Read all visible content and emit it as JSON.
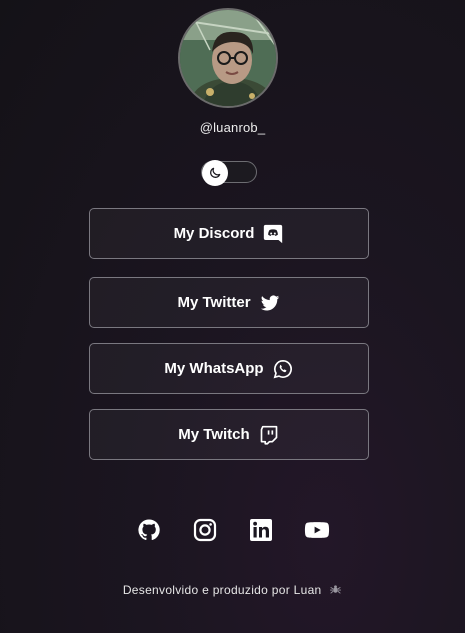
{
  "profile": {
    "username": "@luanrob_",
    "avatar_icon": "profile-photo"
  },
  "theme_toggle": {
    "icon": "moon-icon",
    "state": "dark"
  },
  "links": [
    {
      "label": "My Discord",
      "icon": "discord-icon"
    },
    {
      "label": "My Twitter",
      "icon": "twitter-icon"
    },
    {
      "label": "My WhatsApp",
      "icon": "whatsapp-icon"
    },
    {
      "label": "My Twitch",
      "icon": "twitch-icon"
    }
  ],
  "socials": [
    {
      "icon": "github-icon"
    },
    {
      "icon": "instagram-icon"
    },
    {
      "icon": "linkedin-icon"
    },
    {
      "icon": "youtube-icon"
    }
  ],
  "footer": {
    "text": "Desenvolvido e produzido por Luan",
    "icon": "spider-icon"
  }
}
